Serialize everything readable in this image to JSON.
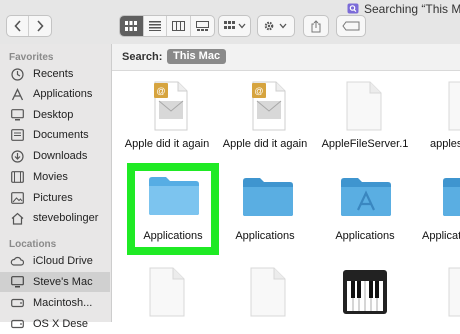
{
  "window": {
    "title": "Searching “This Mac"
  },
  "toolbar": {
    "back": "back",
    "forward": "forward",
    "views": [
      "icon-view",
      "list-view",
      "column-view",
      "gallery-view"
    ]
  },
  "sidebar": {
    "favorites_header": "Favorites",
    "favorites": [
      {
        "label": "Recents",
        "icon": "clock-icon"
      },
      {
        "label": "Applications",
        "icon": "applications-icon"
      },
      {
        "label": "Desktop",
        "icon": "desktop-icon"
      },
      {
        "label": "Documents",
        "icon": "document-icon"
      },
      {
        "label": "Downloads",
        "icon": "download-icon"
      },
      {
        "label": "Movies",
        "icon": "film-icon"
      },
      {
        "label": "Pictures",
        "icon": "photo-icon"
      },
      {
        "label": "stevebolinger",
        "icon": "home-icon"
      }
    ],
    "locations_header": "Locations",
    "locations": [
      {
        "label": "iCloud Drive",
        "icon": "cloud-icon"
      },
      {
        "label": "Steve's Mac",
        "icon": "monitor-icon"
      },
      {
        "label": "Macintosh...",
        "icon": "disk-icon"
      },
      {
        "label": "OS X Dese",
        "icon": "disk-icon"
      }
    ]
  },
  "search": {
    "label": "Search:",
    "scope": "This Mac"
  },
  "files": {
    "row1": [
      "Apple did it again",
      "Apple did it again",
      "AppleFileServer.1",
      "apples"
    ],
    "row2": [
      "Applications",
      "Applications",
      "Applications",
      "Applications"
    ]
  },
  "colors": {
    "selection_highlight": "#1fea24",
    "folder_blue": "#67b9e8"
  }
}
